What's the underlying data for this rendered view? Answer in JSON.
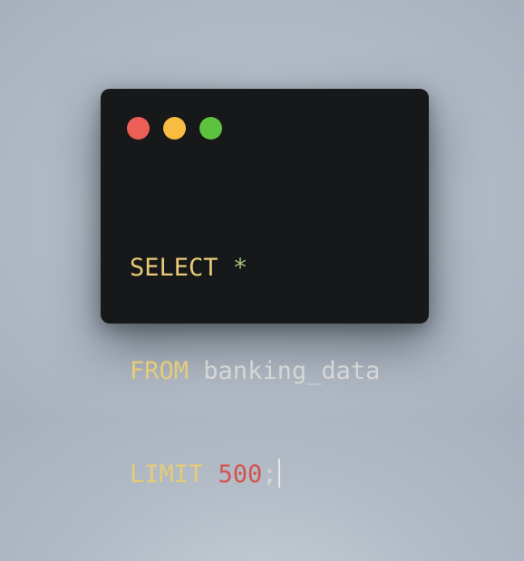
{
  "window": {
    "controls": {
      "close_color": "#ec5f57",
      "minimize_color": "#f7bc41",
      "maximize_color": "#5dc23f"
    }
  },
  "editor": {
    "language": "SQL",
    "lines": [
      {
        "keyword": "SELECT",
        "operator": "*"
      },
      {
        "keyword": "FROM",
        "identifier": "banking_data"
      },
      {
        "keyword": "LIMIT",
        "number": "500",
        "terminator": ";"
      }
    ],
    "colors": {
      "background": "#17181a",
      "keyword": "#e6cc78",
      "operator": "#a4c47c",
      "identifier": "#d6d6d6",
      "number": "#d4534d"
    },
    "cursor_visible": true
  }
}
